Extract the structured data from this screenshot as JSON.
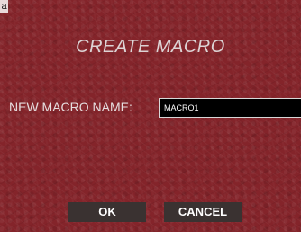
{
  "dialog": {
    "title": "CREATE MACRO",
    "corner_glyph": "a",
    "name_field": {
      "label": "NEW MACRO NAME:",
      "value": "MACRO1"
    },
    "buttons": {
      "ok_label": "OK",
      "cancel_label": "CANCEL"
    }
  },
  "colors": {
    "background": "#84242a",
    "button": "#3a3231",
    "input_bg": "#000000",
    "text_light": "#e6dfe0"
  }
}
